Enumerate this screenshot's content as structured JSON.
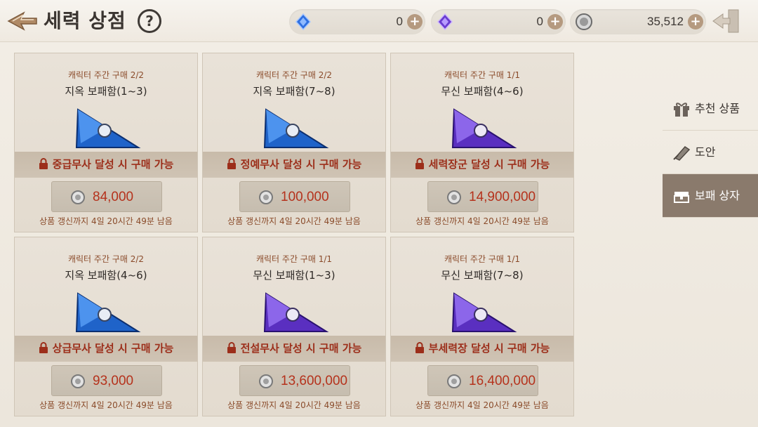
{
  "header": {
    "title": "세력 상점",
    "help_label": "?",
    "currencies": [
      {
        "icon": "blue-crystal-icon",
        "value": "0",
        "plus": "+"
      },
      {
        "icon": "purple-crystal-icon",
        "value": "0",
        "plus": "+"
      },
      {
        "icon": "silver-coin-icon",
        "value": "35,512",
        "plus": "+"
      }
    ]
  },
  "cards": [
    {
      "limit": "캐릭터 주간 구매 2/2",
      "name": "지옥 보패함(1~3)",
      "chest_color": "blue",
      "lock": "중급무사 달성 시 구매 가능",
      "price": "84,000",
      "refresh": "상품 갱신까지 4일 20시간 49분 남음"
    },
    {
      "limit": "캐릭터 주간 구매 2/2",
      "name": "지옥 보패함(7~8)",
      "chest_color": "blue",
      "lock": "정예무사 달성 시 구매 가능",
      "price": "100,000",
      "refresh": "상품 갱신까지 4일 20시간 49분 남음"
    },
    {
      "limit": "캐릭터 주간 구매 1/1",
      "name": "무신 보패함(4~6)",
      "chest_color": "purple",
      "lock": "세력장군 달성 시 구매 가능",
      "price": "14,900,000",
      "refresh": "상품 갱신까지 4일 20시간 49분 남음"
    },
    {
      "limit": "캐릭터 주간 구매 2/2",
      "name": "지옥 보패함(4~6)",
      "chest_color": "blue",
      "lock": "상급무사 달성 시 구매 가능",
      "price": "93,000",
      "refresh": "상품 갱신까지 4일 20시간 49분 남음"
    },
    {
      "limit": "캐릭터 주간 구매 1/1",
      "name": "무신 보패함(1~3)",
      "chest_color": "purple",
      "lock": "전설무사 달성 시 구매 가능",
      "price": "13,600,000",
      "refresh": "상품 갱신까지 4일 20시간 49분 남음"
    },
    {
      "limit": "캐릭터 주간 구매 1/1",
      "name": "무신 보패함(7~8)",
      "chest_color": "purple",
      "lock": "부세력장 달성 시 구매 가능",
      "price": "16,400,000",
      "refresh": "상품 갱신까지 4일 20시간 49분 남음"
    }
  ],
  "sidebar": {
    "items": [
      {
        "label": "추천 상품",
        "icon": "gift-icon",
        "active": false
      },
      {
        "label": "도안",
        "icon": "blueprint-icon",
        "active": false
      },
      {
        "label": "보패 상자",
        "icon": "treasure-chest-icon",
        "active": true
      }
    ]
  },
  "colors": {
    "price_red": "#b5321c",
    "lock_red": "#9c2e1a",
    "active_tab": "#8a7a6c",
    "chest_blue": "#1f63c9",
    "chest_purple": "#5a2fc0"
  }
}
